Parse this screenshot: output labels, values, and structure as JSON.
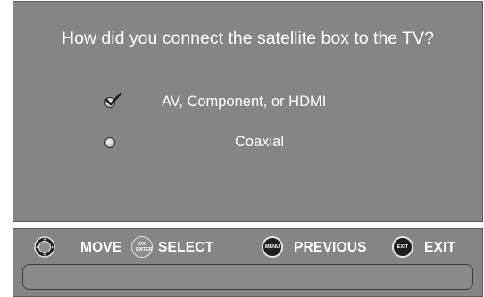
{
  "dialog": {
    "question": "How did you connect the satellite box to the TV?",
    "options": [
      {
        "label": "AV, Component, or HDMI",
        "selected": true
      },
      {
        "label": "Coaxial",
        "selected": false
      }
    ]
  },
  "help_bar": {
    "items": [
      {
        "icon": "dpad-icon",
        "label": "MOVE"
      },
      {
        "icon": "ok-enter-button-icon",
        "icon_text": "OK ENTER",
        "label": "SELECT"
      },
      {
        "icon": "menu-button-icon",
        "icon_text": "MENU",
        "label": "PREVIOUS"
      },
      {
        "icon": "exit-button-icon",
        "icon_text": "EXIT",
        "label": "EXIT"
      }
    ]
  },
  "colors": {
    "panel": "#858585",
    "text": "#ffffff",
    "button_dark": "#1e1e1e"
  }
}
